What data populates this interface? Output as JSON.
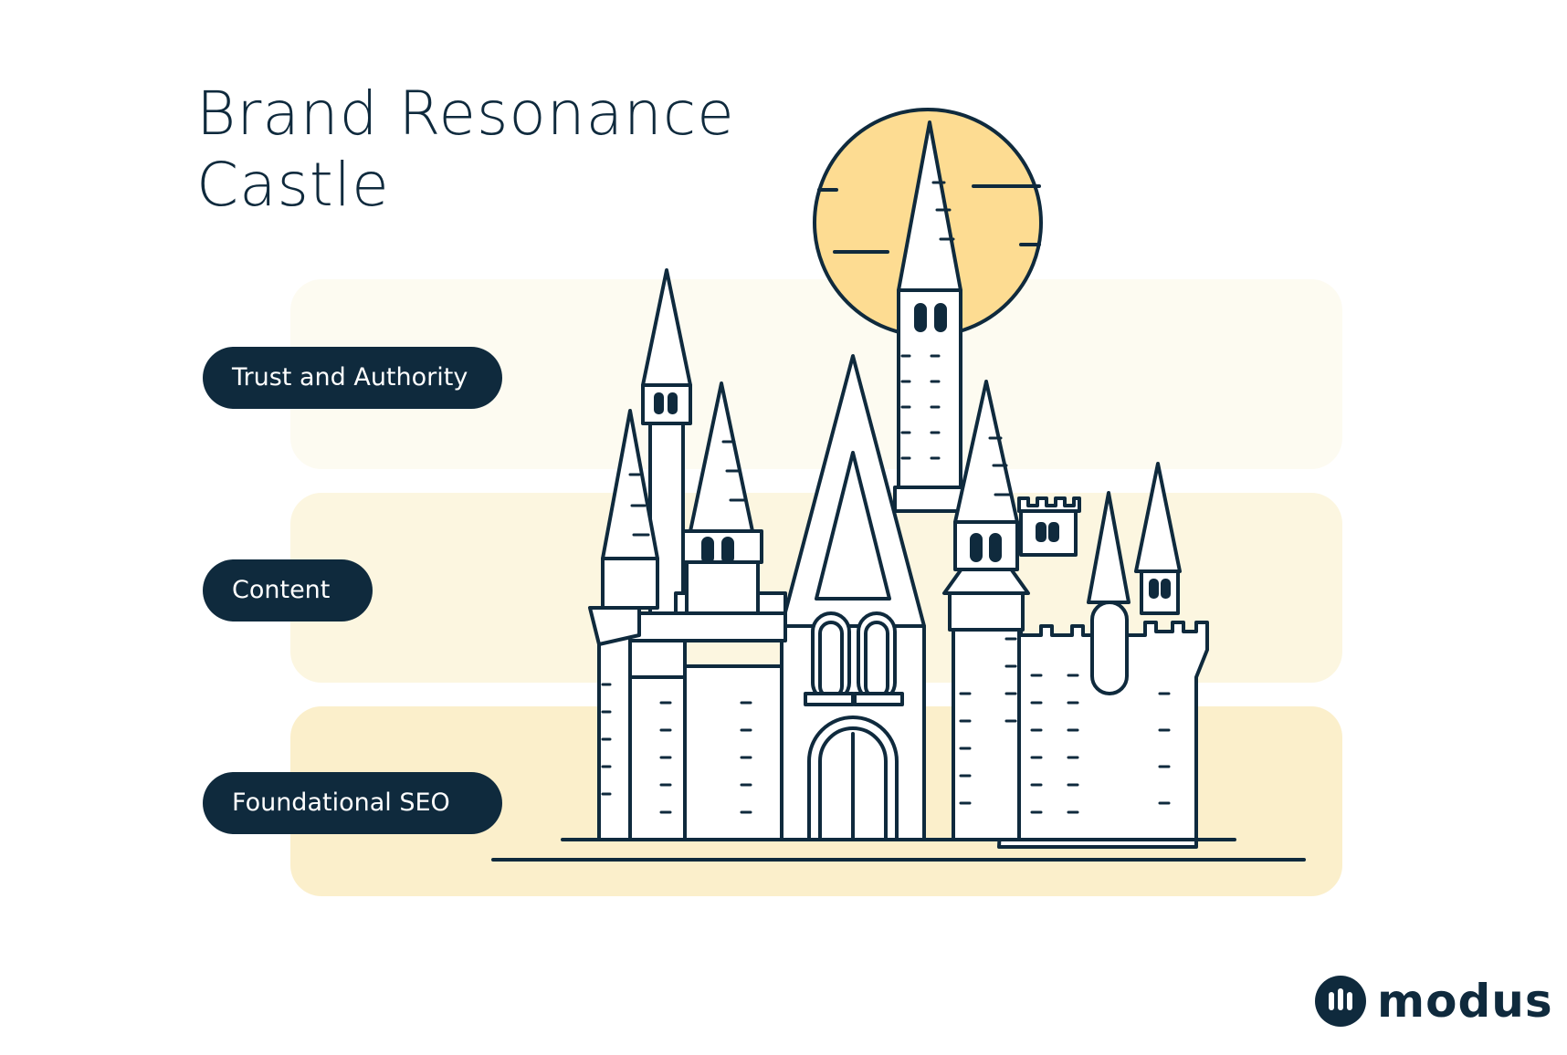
{
  "title": {
    "line1": "Brand Resonance",
    "line2": "Castle"
  },
  "layers": [
    {
      "label": "Trust and Authority"
    },
    {
      "label": "Content"
    },
    {
      "label": "Foundational SEO"
    }
  ],
  "brand": {
    "logo_text": "modus",
    "logo_icon": "modus-logo-icon"
  },
  "colors": {
    "navy": "#0f2a3d",
    "sun": "#fddc92",
    "band_top": "#fdfbf1",
    "band_mid": "#fcf6e0",
    "band_bottom": "#fbefcb"
  }
}
